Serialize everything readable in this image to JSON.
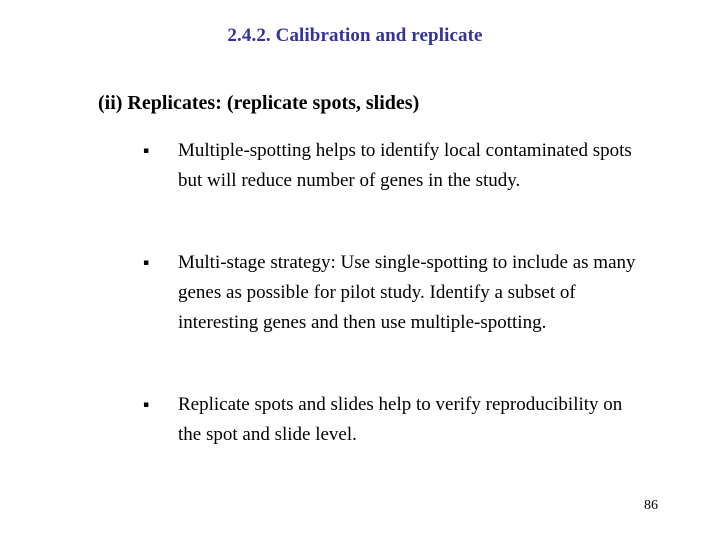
{
  "slide": {
    "title": "2.4.2. Calibration and replicate",
    "title_color": "#333399",
    "subtitle": "(ii) Replicates: (replicate spots, slides)",
    "page_number": "86",
    "background_color": "#ffffff",
    "bullet_marker": "§",
    "bullets": [
      {
        "marker": "▪",
        "text": "Multiple-spotting helps to identify local contaminated spots but will reduce number of genes in the study."
      },
      {
        "marker": "▪",
        "text": "Multi-stage strategy: Use single-spotting to include as many genes as possible for pilot study. Identify a subset of interesting genes and then use multiple-spotting."
      },
      {
        "marker": "▪",
        "text": "Replicate spots and slides help to verify reproducibility on the spot and slide level."
      }
    ]
  }
}
